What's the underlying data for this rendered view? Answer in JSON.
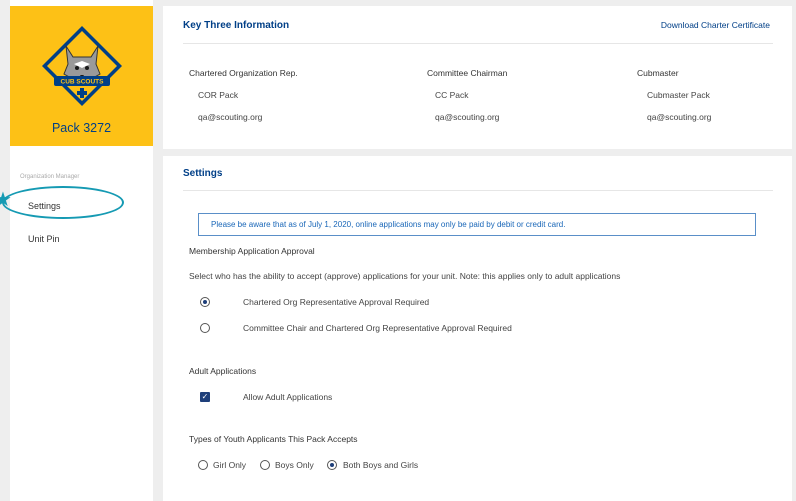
{
  "sidebar": {
    "pack_name": "Pack 3272",
    "logo_text": "CUB SCOUTS",
    "section_label": "Organization Manager",
    "items": [
      {
        "label": "Settings",
        "active": true
      },
      {
        "label": "Unit Pin",
        "active": false
      }
    ]
  },
  "key_three": {
    "title": "Key Three Information",
    "download_link": "Download Charter Certificate",
    "columns": [
      {
        "role": "Chartered Organization Rep.",
        "name": "COR Pack",
        "email": "qa@scouting.org"
      },
      {
        "role": "Committee Chairman",
        "name": "CC Pack",
        "email": "qa@scouting.org"
      },
      {
        "role": "Cubmaster",
        "name": "Cubmaster Pack",
        "email": "qa@scouting.org"
      }
    ]
  },
  "settings": {
    "title": "Settings",
    "notice": "Please be aware that as of July 1, 2020, online applications may only be paid by debit or credit card.",
    "membership": {
      "heading": "Membership Application Approval",
      "description": "Select who has the ability to accept (approve) applications for your unit. Note: this applies only to adult applications",
      "options": [
        {
          "label": "Chartered Org Representative Approval Required",
          "selected": true
        },
        {
          "label": "Committee Chair and Chartered Org Representative Approval Required",
          "selected": false
        }
      ]
    },
    "adult": {
      "heading": "Adult Applications",
      "checkbox_label": "Allow Adult Applications",
      "checked": true
    },
    "youth": {
      "heading": "Types of Youth Applicants This Pack Accepts",
      "options": [
        {
          "label": "Girl Only",
          "selected": false
        },
        {
          "label": "Boys Only",
          "selected": false
        },
        {
          "label": "Both Boys and Girls",
          "selected": true
        }
      ]
    }
  },
  "colors": {
    "brand_yellow": "#fdc116",
    "brand_blue": "#003f87",
    "highlight": "#159ab3",
    "notice_border": "#5a8fc8"
  }
}
